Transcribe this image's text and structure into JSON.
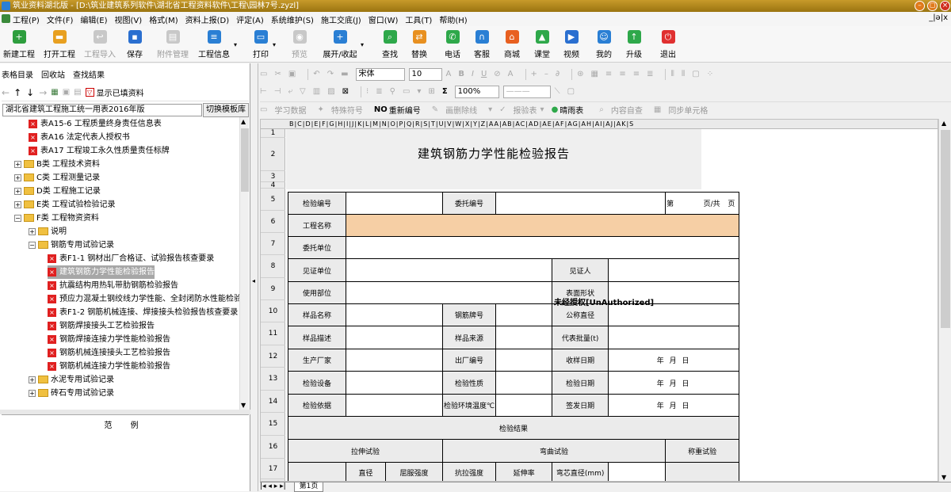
{
  "window": {
    "title": "筑业资料湖北版 - [D:\\筑业建筑系列软件\\湖北省工程资料软件\\工程\\园林7号.zyzl]"
  },
  "menu": {
    "items": [
      "工程(P)",
      "文件(F)",
      "编辑(E)",
      "视图(V)",
      "格式(M)",
      "资料上报(D)",
      "评定(A)",
      "系统维护(S)",
      "施工交底(J)",
      "窗口(W)",
      "工具(T)",
      "帮助(H)"
    ],
    "right_controls": "_|ǝ|x"
  },
  "toolbar": {
    "new_project": "新建工程",
    "open_project": "打开工程",
    "import_project": "工程导入",
    "save": "保存",
    "attachment": "附件管理",
    "project_info": "工程信息",
    "print": "打印",
    "preview": "预览",
    "expand_collapse": "展开/收起",
    "find": "查找",
    "replace": "替换",
    "phone": "电话",
    "support": "客服",
    "store": "商城",
    "classroom": "课堂",
    "video": "视频",
    "mine": "我的",
    "upgrade": "升级",
    "exit": "退出"
  },
  "left": {
    "tabs": [
      "表格目录",
      "回收站",
      "查找结果"
    ],
    "show_filled": "显示已填资料",
    "template_select": "湖北省建筑工程施工统一用表2016年版",
    "switch_button": "切换模板库",
    "tree": [
      {
        "indent": 2,
        "kind": "x",
        "label": "表A15-6 工程质量终身责任信息表"
      },
      {
        "indent": 2,
        "kind": "x",
        "label": "表A16 法定代表人授权书"
      },
      {
        "indent": 2,
        "kind": "x",
        "label": "表A17 工程竣工永久性质量责任标牌"
      },
      {
        "indent": 1,
        "kind": "folder",
        "label": "B类 工程技术资料"
      },
      {
        "indent": 1,
        "kind": "folder",
        "label": "C类 工程测量记录"
      },
      {
        "indent": 1,
        "kind": "folder",
        "label": "D类 工程施工记录"
      },
      {
        "indent": 1,
        "kind": "folder",
        "label": "E类 工程试验检验记录"
      },
      {
        "indent": 1,
        "kind": "folder-open",
        "label": "F类 工程物资资料"
      },
      {
        "indent": 2,
        "kind": "folder",
        "label": "说明"
      },
      {
        "indent": 2,
        "kind": "folder-open",
        "label": "钢筋专用试验记录"
      },
      {
        "indent": 3,
        "kind": "x",
        "label": "表F1-1 钢材出厂合格证、试验报告核查要录"
      },
      {
        "indent": 3,
        "kind": "x",
        "label": "建筑钢筋力学性能检验报告",
        "selected": true
      },
      {
        "indent": 3,
        "kind": "x",
        "label": "抗震结构用热轧带肋钢筋检验报告"
      },
      {
        "indent": 3,
        "kind": "x",
        "label": "预应力混凝土钢绞线力学性能、全封闭防水性能检验"
      },
      {
        "indent": 3,
        "kind": "x",
        "label": "表F1-2 钢筋机械连接、焊接接头检验报告核查要录"
      },
      {
        "indent": 3,
        "kind": "x",
        "label": "钢筋焊接接头工艺检验报告"
      },
      {
        "indent": 3,
        "kind": "x",
        "label": "钢筋焊接连接力学性能检验报告"
      },
      {
        "indent": 3,
        "kind": "x",
        "label": "钢筋机械连接接头工艺检验报告"
      },
      {
        "indent": 3,
        "kind": "x",
        "label": "钢筋机械连接力学性能检验报告"
      },
      {
        "indent": 2,
        "kind": "folder",
        "label": "水泥专用试验记录"
      },
      {
        "indent": 2,
        "kind": "folder",
        "label": "砖石专用试验记录"
      }
    ],
    "example_label": "范 例"
  },
  "format_toolbar": {
    "font_name": "宋体",
    "font_size": "10",
    "zoom": "100%",
    "bold": "B",
    "italic": "I",
    "underline": "U"
  },
  "data_toolbar": {
    "study_data": "学习数据",
    "special_char": "特殊符号",
    "renumber": "重新编号",
    "draw_slash": "画删除线",
    "report_table": "报验表",
    "weather": "晴雨表",
    "content_check": "内容自查",
    "merge_cells": "同步单元格"
  },
  "sheet": {
    "columns": "B|C|D|E|F|G|H|I|J|K|L|M|N|O|P|Q|R|S|T|U|V|W|X|Y|Z|AA|AB|AC|AD|AE|AF|AG|AH|AI|AJ|AK|S",
    "rows": [
      "1",
      "2",
      "3",
      "4",
      "5",
      "6",
      "7",
      "8",
      "9",
      "10",
      "11",
      "12",
      "13",
      "14",
      "15",
      "16",
      "17"
    ],
    "title": "建筑钢筋力学性能检验报告",
    "watermark": "未经授权[UnAuthorized]",
    "labels": {
      "test_no": "检验编号",
      "entrust_no": "委托编号",
      "page_di": "第",
      "page_of": "页/共",
      "page_ye": "页",
      "project_name": "工程名称",
      "entrust_unit": "委托单位",
      "witness_unit": "见证单位",
      "witness": "见证人",
      "use_part": "使用部位",
      "surface_shape": "表面形状",
      "sample_name": "样品名称",
      "steel_grade": "钢筋牌号",
      "nominal_dia": "公称直径",
      "sample_desc": "样品描述",
      "sample_source": "样品来源",
      "rep_batch": "代表批量(t)",
      "manufacturer": "生产厂家",
      "factory_no": "出厂编号",
      "receive_date": "收样日期",
      "test_equipment": "检验设备",
      "test_nature": "检验性质",
      "test_date": "检验日期",
      "test_basis": "检验依据",
      "env_temp": "检验环境温度℃",
      "issue_date": "签发日期",
      "date_template": "年 月 日",
      "results": "检验结果",
      "tensile": "拉伸试验",
      "bend": "弯曲试验",
      "weigh": "称重试验",
      "diameter": "直径",
      "yield": "屈服强度",
      "tensile_strength": "抗拉强度",
      "elongation": "延伸率",
      "mandrel": "弯芯直径(mm)"
    }
  },
  "sheet_tabs": {
    "nav": "|◂ ◂ ▸ ▸|",
    "active": "第1页"
  }
}
